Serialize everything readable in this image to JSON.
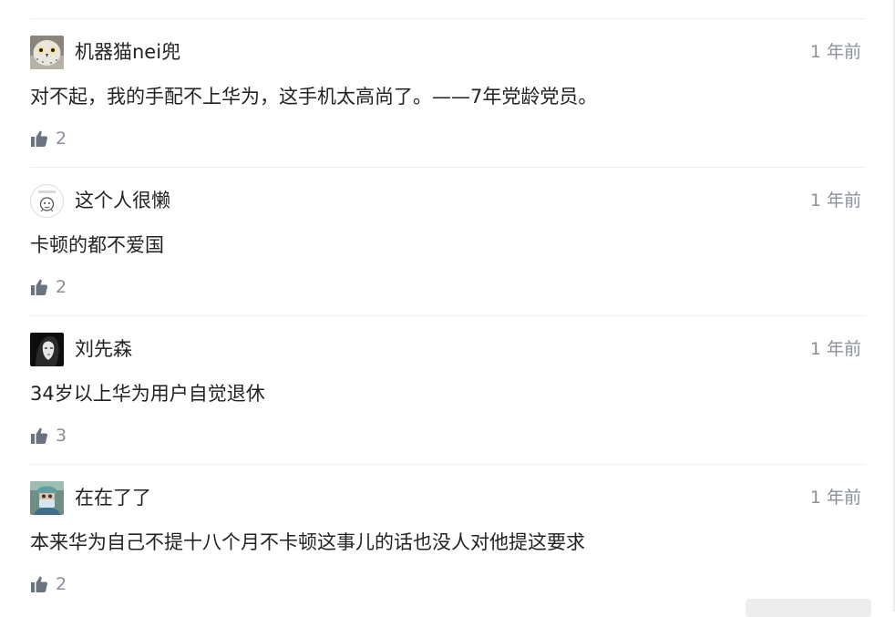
{
  "comments": [
    {
      "username": "机器猫nei兜",
      "time": "1 年前",
      "text": "对不起，我的手配不上华为，这手机太高尚了。——7年党龄党员。",
      "likes": "2",
      "avatar": "owl-avatar"
    },
    {
      "username": "这个人很懒",
      "time": "1 年前",
      "text": "卡顿的都不爱国",
      "likes": "2",
      "avatar": "cartoon-avatar"
    },
    {
      "username": "刘先森",
      "time": "1 年前",
      "text": "34岁以上华为用户自觉退休",
      "likes": "3",
      "avatar": "portrait-avatar"
    },
    {
      "username": "在在了了",
      "time": "1 年前",
      "text": "本来华为自己不提十八个月不卡顿这事儿的话也没人对他提这要求",
      "likes": "2",
      "avatar": "masked-person-avatar"
    }
  ],
  "icons": {
    "like": "thumbs-up-icon"
  },
  "colors": {
    "text": "#222222",
    "muted": "#8a8f99",
    "divider": "#eeeeee",
    "icon": "#6b7280"
  }
}
